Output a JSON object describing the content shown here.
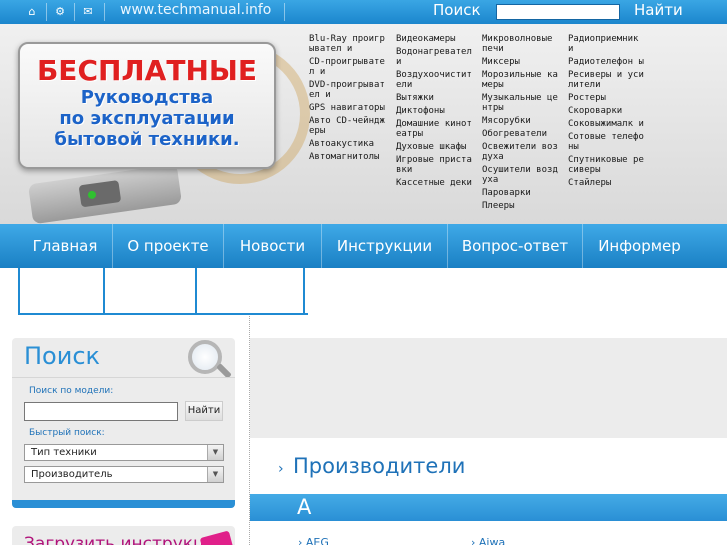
{
  "topbar": {
    "icons": [
      "home-icon",
      "sitemap-icon",
      "mail-icon"
    ],
    "site_url": "www.techmanual.info",
    "search_label": "Поиск",
    "search_value": "",
    "find_button": "Найти"
  },
  "banner": {
    "line1": "БЕСПЛАТНЫЕ",
    "line2": "Руководства",
    "line3": "по эксплуатации",
    "line4": "бытовой техники."
  },
  "categories": {
    "col1": [
      "Blu-Ray проигрывател и",
      "CD-проигрывател и",
      "DVD-проигрывател и",
      "GPS навигаторы",
      "Авто CD-чейнджеры",
      "Автоакустика",
      "Автомагнитолы"
    ],
    "col2": [
      "Видеокамеры",
      "Водонагревател и",
      "Воздухоочистители",
      "Вытяжки",
      "Диктофоны",
      "Домашние кинотеатры",
      "Духовые шкафы",
      "Игровые приставки",
      "Кассетные деки"
    ],
    "col3": [
      "Микроволновые печи",
      "Миксеры",
      "Морозильные камеры",
      "Музыкальные центры",
      "Мясорубки",
      "Обогреватели",
      "Освежители воздуха",
      "Осушители воздуха",
      "Пароварки",
      "Плееры"
    ],
    "col4": [
      "Радиоприемник и",
      "Радиотелефон ы",
      "Ресиверы и усилители",
      "Ростеры",
      "Скороварки",
      "Соковыжималк и",
      "Сотовые телефоны",
      "Спутниковые ресиверы",
      "Стайлеры"
    ]
  },
  "mainnav": [
    "Главная",
    "О проекте",
    "Новости",
    "Инструкции",
    "Вопрос-ответ",
    "Информер"
  ],
  "search_panel": {
    "title": "Поиск",
    "model_label": "Поиск по модели:",
    "model_value": "",
    "find_button": "Найти",
    "quick_label": "Быстрый поиск:",
    "type_select": "Тип техники",
    "maker_select": "Производитель"
  },
  "upload_panel": {
    "title": "Загрузить инструкцию"
  },
  "manufacturers": {
    "title": "Производители",
    "letter": "A",
    "brands": [
      "AEG",
      "Aiwa"
    ]
  },
  "colors": {
    "accent": "#2a8fd5",
    "banner_red": "#e02020",
    "banner_blue": "#1c63c8",
    "upload_pink": "#b0127a"
  }
}
